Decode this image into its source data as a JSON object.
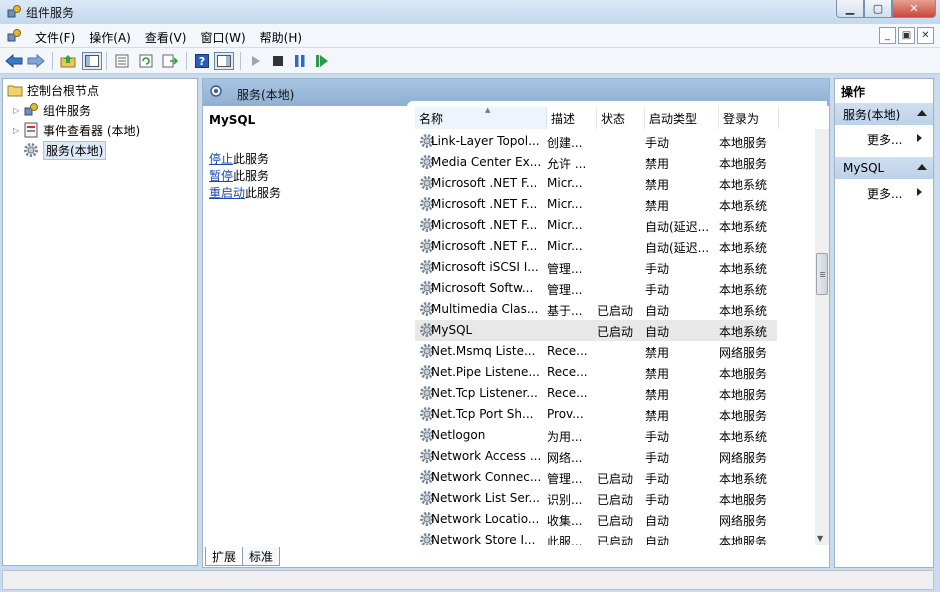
{
  "window": {
    "title": "组件服务"
  },
  "menu": [
    "文件(F)",
    "操作(A)",
    "查看(V)",
    "窗口(W)",
    "帮助(H)"
  ],
  "tree": {
    "root": "控制台根节点",
    "items": [
      "组件服务",
      "事件查看器 (本地)",
      "服务(本地)"
    ]
  },
  "center": {
    "header": "服务(本地)",
    "selected_name": "MySQL",
    "actions": [
      {
        "link": "停止",
        "rest": "此服务"
      },
      {
        "link": "暂停",
        "rest": "此服务"
      },
      {
        "link": "重启动",
        "rest": "此服务"
      }
    ],
    "columns": [
      "名称",
      "描述",
      "状态",
      "启动类型",
      "登录为"
    ],
    "rows": [
      [
        "Link-Layer Topol...",
        "创建...",
        "",
        "手动",
        "本地服务"
      ],
      [
        "Media Center Ex...",
        "允许 ...",
        "",
        "禁用",
        "本地服务"
      ],
      [
        "Microsoft .NET F...",
        "Micr...",
        "",
        "禁用",
        "本地系统"
      ],
      [
        "Microsoft .NET F...",
        "Micr...",
        "",
        "禁用",
        "本地系统"
      ],
      [
        "Microsoft .NET F...",
        "Micr...",
        "",
        "自动(延迟...",
        "本地系统"
      ],
      [
        "Microsoft .NET F...",
        "Micr...",
        "",
        "自动(延迟...",
        "本地系统"
      ],
      [
        "Microsoft iSCSI I...",
        "管理...",
        "",
        "手动",
        "本地系统"
      ],
      [
        "Microsoft Softw...",
        "管理...",
        "",
        "手动",
        "本地系统"
      ],
      [
        "Multimedia Clas...",
        "基于...",
        "已启动",
        "自动",
        "本地系统"
      ],
      [
        "MySQL",
        "",
        "已启动",
        "自动",
        "本地系统"
      ],
      [
        "Net.Msmq Liste...",
        "Rece...",
        "",
        "禁用",
        "网络服务"
      ],
      [
        "Net.Pipe Listene...",
        "Rece...",
        "",
        "禁用",
        "本地服务"
      ],
      [
        "Net.Tcp Listener...",
        "Rece...",
        "",
        "禁用",
        "本地服务"
      ],
      [
        "Net.Tcp Port Sh...",
        "Prov...",
        "",
        "禁用",
        "本地服务"
      ],
      [
        "Netlogon",
        "为用...",
        "",
        "手动",
        "本地系统"
      ],
      [
        "Network Access ...",
        "网络...",
        "",
        "手动",
        "网络服务"
      ],
      [
        "Network Connec...",
        "管理...",
        "已启动",
        "手动",
        "本地系统"
      ],
      [
        "Network List Ser...",
        "识别...",
        "已启动",
        "手动",
        "本地服务"
      ],
      [
        "Network Locatio...",
        "收集...",
        "已启动",
        "自动",
        "网络服务"
      ],
      [
        "Network Store I...",
        "此服...",
        "已启动",
        "自动",
        "本地服务"
      ]
    ],
    "selected_row": 9,
    "tabs": [
      "扩展",
      "标准"
    ]
  },
  "actions_pane": {
    "title": "操作",
    "sections": [
      {
        "name": "服务(本地)",
        "more": "更多..."
      },
      {
        "name": "MySQL",
        "more": "更多..."
      }
    ]
  },
  "colors": {
    "accent": "#1848b0",
    "header": "#9fbbd9"
  }
}
